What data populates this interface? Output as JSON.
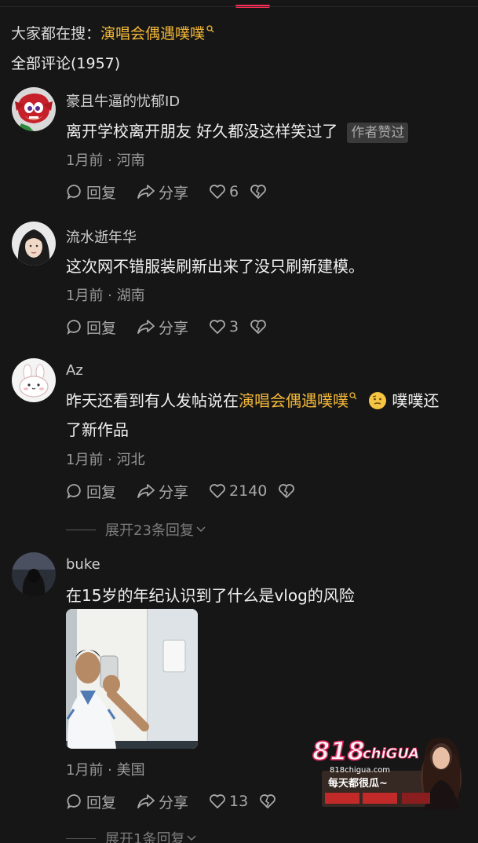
{
  "search": {
    "prefix": "大家都在搜：",
    "keyword": "演唱会偶遇噗噗"
  },
  "comment_count_label": "全部评论(1957)",
  "actions": {
    "reply": "回复",
    "share": "分享"
  },
  "comments": [
    {
      "username": "豪且牛逼的忧郁ID",
      "text": "离开学校离开朋友 好久都没这样笑过了",
      "badge": "作者赞过",
      "meta": "1月前 · 河南",
      "likes": "6"
    },
    {
      "username": "流水逝年华",
      "text": "这次网不错服装刷新出来了没只刷新建模。",
      "meta": "1月前 · 湖南",
      "likes": "3"
    },
    {
      "username": "Az",
      "text_before": "昨天还看到有人发帖说在",
      "keyword": "演唱会偶遇噗噗",
      "text_after": "噗噗还",
      "text_line2": "了新作品",
      "meta": "1月前 · 河北",
      "likes": "2140",
      "expand": "展开23条回复"
    },
    {
      "username": "buke",
      "text": "在15岁的年纪认识到了什么是vlog的风险",
      "meta": "1月前 · 美国",
      "likes": "13",
      "expand": "展开1条回复"
    }
  ],
  "ad": {
    "brand": "818",
    "brand_sub": "chiGUA",
    "site": "818chigua.com",
    "slogan": "每天都很瓜~"
  },
  "colors": {
    "background": "#161616",
    "keyword": "#f2b739",
    "accent": "#fe2c55"
  }
}
